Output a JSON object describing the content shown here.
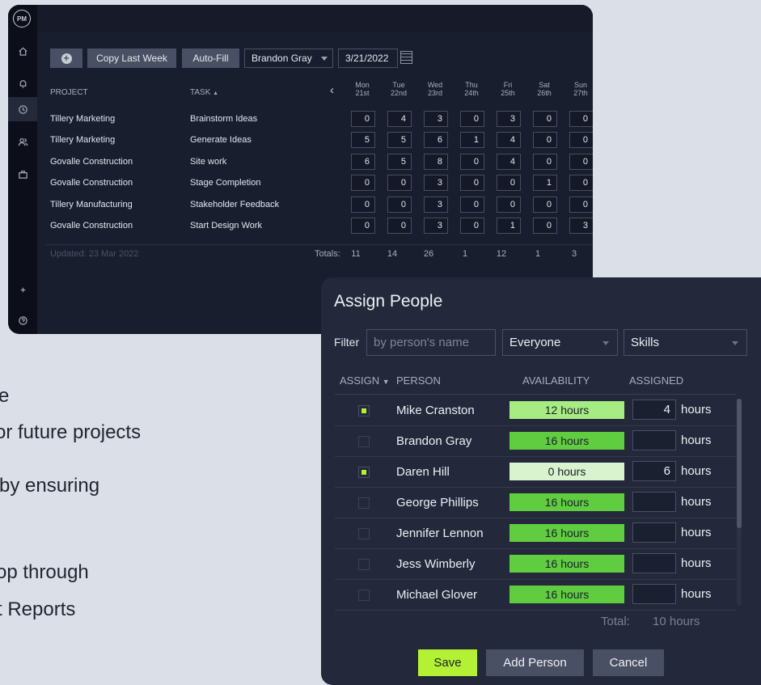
{
  "background_text": [
    {
      "text": "e"
    },
    {
      "text": "or future projects"
    },
    {
      "text": "by ensuring"
    },
    {
      "text": "op through"
    },
    {
      "text": "t Reports"
    }
  ],
  "logo": {
    "text": "PM"
  },
  "toolbar": {
    "copy_label": "Copy Last Week",
    "autofill_label": "Auto-Fill",
    "person_value": "Brandon Gray",
    "date_value": "3/21/2022"
  },
  "table": {
    "project_header": "PROJECT",
    "task_header": "TASK",
    "task_sort_indicator": "▲",
    "days": [
      {
        "name": "Mon",
        "date": "21st"
      },
      {
        "name": "Tue",
        "date": "22nd"
      },
      {
        "name": "Wed",
        "date": "23rd"
      },
      {
        "name": "Thu",
        "date": "24th"
      },
      {
        "name": "Fri",
        "date": "25th"
      },
      {
        "name": "Sat",
        "date": "26th"
      },
      {
        "name": "Sun",
        "date": "27th"
      }
    ],
    "rows": [
      {
        "project": "Tillery Marketing",
        "task": "Brainstorm Ideas",
        "hours": [
          "0",
          "4",
          "3",
          "0",
          "3",
          "0",
          "0"
        ]
      },
      {
        "project": "Tillery Marketing",
        "task": "Generate Ideas",
        "hours": [
          "5",
          "5",
          "6",
          "1",
          "4",
          "0",
          "0"
        ]
      },
      {
        "project": "Govalle Construction",
        "task": "Site work",
        "hours": [
          "6",
          "5",
          "8",
          "0",
          "4",
          "0",
          "0"
        ]
      },
      {
        "project": "Govalle Construction",
        "task": "Stage Completion",
        "hours": [
          "0",
          "0",
          "3",
          "0",
          "0",
          "1",
          "0"
        ]
      },
      {
        "project": "Tillery Manufacturing",
        "task": "Stakeholder Feedback",
        "hours": [
          "0",
          "0",
          "3",
          "0",
          "0",
          "0",
          "0"
        ]
      },
      {
        "project": "Govalle Construction",
        "task": "Start Design Work",
        "hours": [
          "0",
          "0",
          "3",
          "0",
          "1",
          "0",
          "3"
        ]
      }
    ],
    "updated": "Updated: 23 Mar 2022",
    "totals_label": "Totals:",
    "totals": [
      "11",
      "14",
      "26",
      "1",
      "12",
      "1",
      "3"
    ]
  },
  "modal": {
    "title": "Assign People",
    "filter_label": "Filter",
    "filter_placeholder": "by person's name",
    "group_select": "Everyone",
    "skills_select": "Skills",
    "headers": {
      "assign": "ASSIGN",
      "assign_sort": "▼",
      "person": "PERSON",
      "availability": "AVAILABILITY",
      "assigned": "ASSIGNED"
    },
    "hours_unit": "hours",
    "people": [
      {
        "name": "Mike Cranston",
        "checked": true,
        "availability": "12 hours",
        "avail_color": "#a6ec83",
        "assigned": "4"
      },
      {
        "name": "Brandon Gray",
        "checked": false,
        "availability": "16 hours",
        "avail_color": "#5fcd3f",
        "assigned": ""
      },
      {
        "name": "Daren Hill",
        "checked": true,
        "availability": "0 hours",
        "avail_color": "#d8f3cd",
        "assigned": "6"
      },
      {
        "name": "George Phillips",
        "checked": false,
        "availability": "16 hours",
        "avail_color": "#5fcd3f",
        "assigned": ""
      },
      {
        "name": "Jennifer Lennon",
        "checked": false,
        "availability": "16 hours",
        "avail_color": "#5fcd3f",
        "assigned": ""
      },
      {
        "name": "Jess Wimberly",
        "checked": false,
        "availability": "16 hours",
        "avail_color": "#5fcd3f",
        "assigned": ""
      },
      {
        "name": "Michael Glover",
        "checked": false,
        "availability": "16 hours",
        "avail_color": "#5fcd3f",
        "assigned": ""
      }
    ],
    "total_label": "Total:",
    "total_value": "10 hours",
    "save_label": "Save",
    "add_person_label": "Add Person",
    "cancel_label": "Cancel"
  },
  "colors": {
    "accent": "#b4f033",
    "panel": "#191e2f",
    "modal": "#23283a"
  }
}
